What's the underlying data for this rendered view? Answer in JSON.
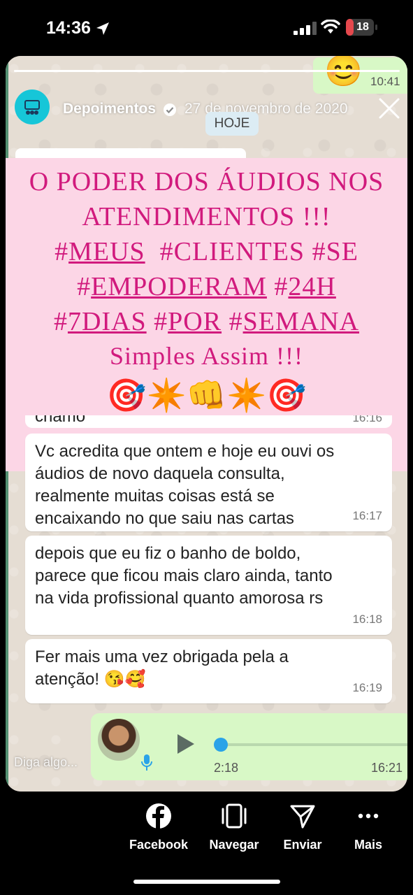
{
  "status_bar": {
    "time": "14:36",
    "battery": "18",
    "icons": [
      "location-arrow-icon",
      "signal-icon",
      "wifi-icon",
      "battery-icon"
    ],
    "battery_color": "#e5484d"
  },
  "story": {
    "progress": 1.0,
    "account_name": "Depoimentos",
    "date": "27 de novembro de 2020",
    "reply_placeholder": "Diga algo..."
  },
  "chat": {
    "top_message": {
      "emoji": "😊",
      "time": "10:41"
    },
    "date_chip": "HOJE",
    "partial_message": {
      "text": "chamo",
      "time": "16:16"
    },
    "messages": [
      {
        "text": "Vc acredita que ontem e hoje eu ouvi os\náudios de novo daquela consulta,\nrealmente muitas coisas está se\nencaixando no que saiu nas cartas",
        "time": "16:17"
      },
      {
        "text": "depois que eu fiz o banho de boldo,\nparece que ficou mais claro ainda, tanto\nna vida profissional quanto amorosa rs",
        "time": "16:18"
      },
      {
        "text": "Fer mais uma vez obrigada pela a\natenção! 😘🥰",
        "time": "16:19"
      }
    ],
    "audio": {
      "duration": "2:18",
      "time": "16:21",
      "progress": 0.0
    }
  },
  "overlay": {
    "line1": "O PODER DOS ÁUDIOS NOS",
    "line2": "ATENDIMENTOS !!!",
    "line3_tags": [
      "#",
      "MEUS",
      "  #",
      "CLIENTES",
      " #",
      "SE"
    ],
    "line4_tags": [
      "#",
      "EMPODERAM",
      " #",
      "24H"
    ],
    "line5_tags": [
      "#",
      "7DIAS",
      " #",
      "POR",
      " #",
      "SEMANA"
    ],
    "line6": "Simples Assim !!!",
    "emojis": "🎯✴️👊✴️🎯",
    "background_color": "#fcd6e6",
    "text_color": "#d11a7d"
  },
  "actions": [
    {
      "label": "Facebook",
      "icon": "facebook-icon"
    },
    {
      "label": "Navegar",
      "icon": "browse-icon"
    },
    {
      "label": "Enviar",
      "icon": "send-icon"
    },
    {
      "label": "Mais",
      "icon": "more-icon"
    }
  ]
}
